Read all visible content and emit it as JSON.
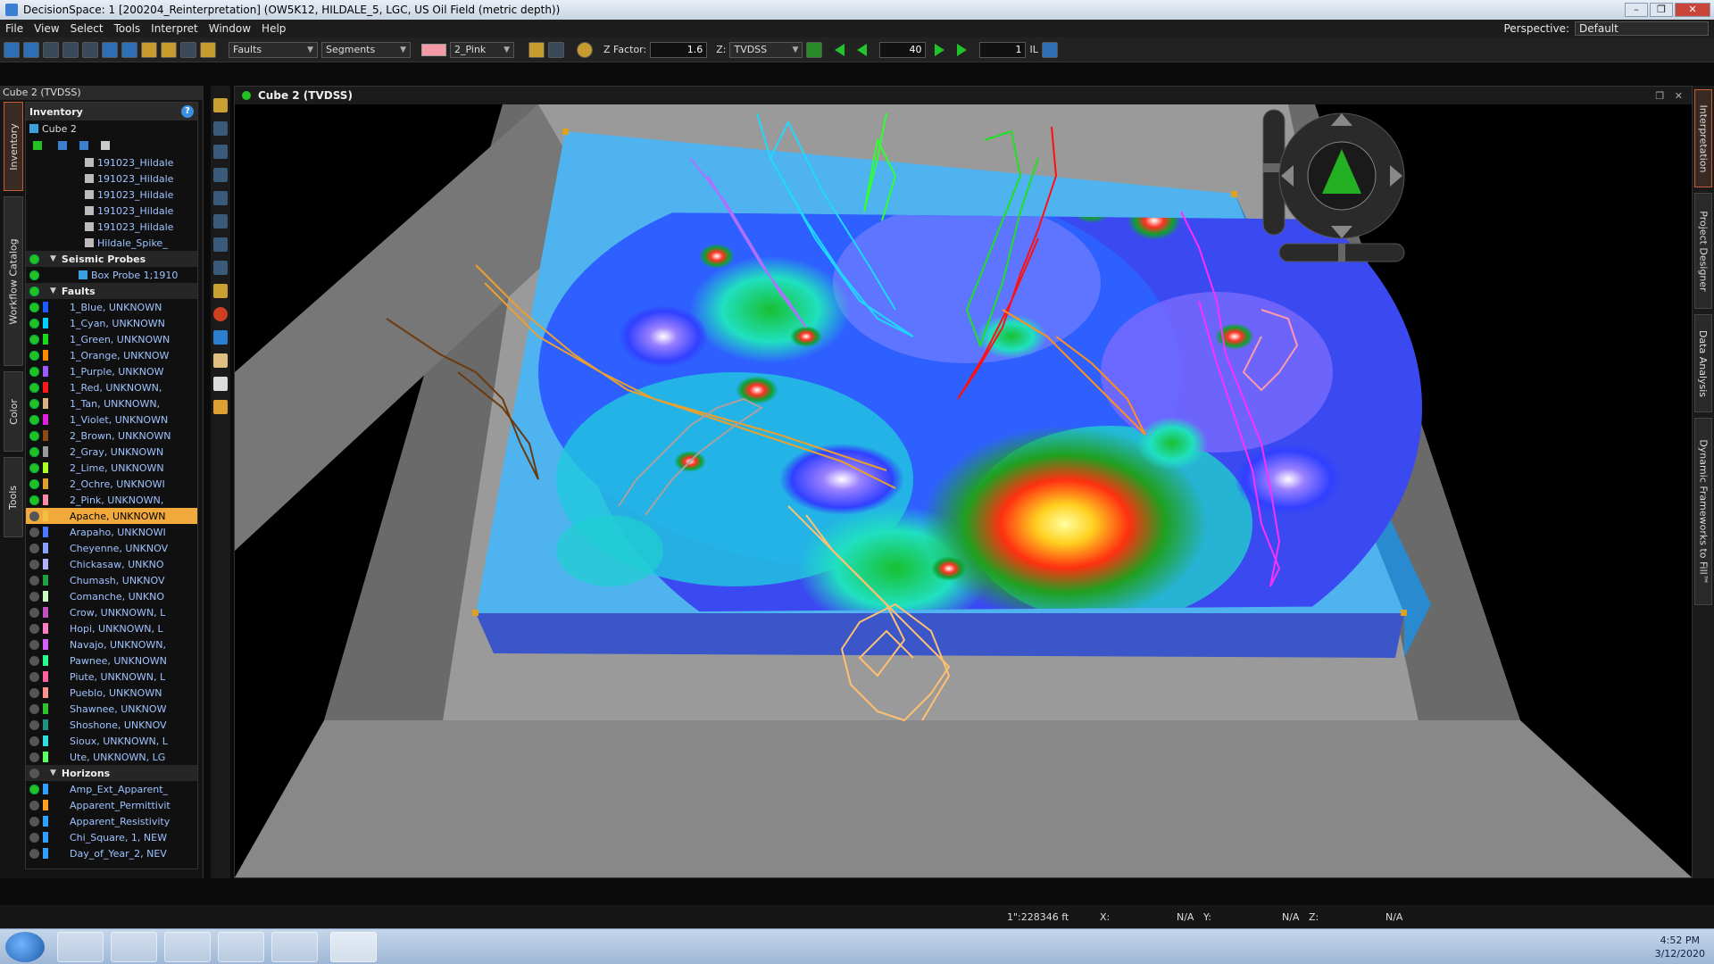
{
  "window": {
    "title": "DecisionSpace: 1 [200204_Reinterpretation] (OW5K12, HILDALE_5, LGC, US Oil Field (metric depth))"
  },
  "menu": [
    "File",
    "View",
    "Select",
    "Tools",
    "Interpret",
    "Window",
    "Help"
  ],
  "perspective": {
    "label": "Perspective:",
    "value": "Default"
  },
  "toolbar": {
    "layer_dropdown": "Faults",
    "mode_dropdown": "Segments",
    "fault_dropdown": "2_Pink",
    "zfactor_label": "Z Factor:",
    "zfactor_value": "1.6",
    "z_label": "Z:",
    "z_dropdown": "TVDSS",
    "frame_value": "40",
    "step_value": "1",
    "il_label": "IL"
  },
  "left_panel": {
    "title": "Cube 2 (TVDSS)",
    "vertical_tabs": [
      "Inventory",
      "Workflow Catalog",
      "Color",
      "Tools"
    ],
    "inventory_title": "Inventory",
    "cube_label": "Cube 2",
    "items": [
      {
        "label": "191023_Hildale",
        "kind": "file"
      },
      {
        "label": "191023_Hildale",
        "kind": "file"
      },
      {
        "label": "191023_Hildale",
        "kind": "file"
      },
      {
        "label": "191023_Hildale",
        "kind": "file"
      },
      {
        "label": "191023_Hildale",
        "kind": "file"
      },
      {
        "label": "Hildale_Spike_",
        "kind": "file"
      }
    ],
    "seismic_group": "Seismic Probes",
    "seismic_items": [
      {
        "label": "Box Probe 1;1910"
      }
    ],
    "faults_group": "Faults",
    "faults": [
      {
        "label": "1_Blue, UNKNOWN",
        "color": "#1f5cff",
        "on": true
      },
      {
        "label": "1_Cyan, UNKNOWN",
        "color": "#00d0ff",
        "on": true
      },
      {
        "label": "1_Green, UNKNOWN",
        "color": "#18d818",
        "on": true
      },
      {
        "label": "1_Orange, UNKNOW",
        "color": "#ff8c00",
        "on": true
      },
      {
        "label": "1_Purple, UNKNOW",
        "color": "#9b59ff",
        "on": true
      },
      {
        "label": "1_Red, UNKNOWN,",
        "color": "#ff1a1a",
        "on": true
      },
      {
        "label": "1_Tan, UNKNOWN,",
        "color": "#d9b384",
        "on": true
      },
      {
        "label": "1_Violet, UNKNOWN",
        "color": "#e020e0",
        "on": true
      },
      {
        "label": "2_Brown, UNKNOWN",
        "color": "#8a4a12",
        "on": true
      },
      {
        "label": "2_Gray, UNKNOWN",
        "color": "#9a9a9a",
        "on": true
      },
      {
        "label": "2_Lime, UNKNOWN",
        "color": "#a8ff20",
        "on": true
      },
      {
        "label": "2_Ochre, UNKNOWI",
        "color": "#e0a030",
        "on": true
      },
      {
        "label": "2_Pink, UNKNOWN,",
        "color": "#ff8aa8",
        "on": true
      },
      {
        "label": "Apache, UNKNOWN",
        "color": "#f2c040",
        "on": false,
        "selected": true
      },
      {
        "label": "Arapaho, UNKNOWI",
        "color": "#4a7aff",
        "on": false
      },
      {
        "label": "Cheyenne, UNKNOV",
        "color": "#8aa0ff",
        "on": false
      },
      {
        "label": "Chickasaw, UNKNO",
        "color": "#b0b0ff",
        "on": false
      },
      {
        "label": "Chumash, UNKNOV",
        "color": "#20a040",
        "on": false
      },
      {
        "label": "Comanche, UNKNO",
        "color": "#c8ffc0",
        "on": false
      },
      {
        "label": "Crow, UNKNOWN, L",
        "color": "#c050c0",
        "on": false
      },
      {
        "label": "Hopi, UNKNOWN, L",
        "color": "#ff80c0",
        "on": false
      },
      {
        "label": "Navajo, UNKNOWN,",
        "color": "#d060ff",
        "on": false
      },
      {
        "label": "Pawnee, UNKNOWN",
        "color": "#20ff90",
        "on": false
      },
      {
        "label": "Piute, UNKNOWN, L",
        "color": "#ff60a0",
        "on": false
      },
      {
        "label": "Pueblo, UNKNOWN",
        "color": "#ff9090",
        "on": false
      },
      {
        "label": "Shawnee, UNKNOW",
        "color": "#30c030",
        "on": false
      },
      {
        "label": "Shoshone, UNKNOV",
        "color": "#209080",
        "on": false
      },
      {
        "label": "Sioux, UNKNOWN, L",
        "color": "#30e0e0",
        "on": false
      },
      {
        "label": "Ute, UNKNOWN, LG",
        "color": "#60ff60",
        "on": false
      }
    ],
    "horizons_group": "Horizons",
    "horizons": [
      {
        "label": "Amp_Ext_Apparent_",
        "color": "#30a0ff",
        "on": true
      },
      {
        "label": "Apparent_Permittivit",
        "color": "#ffa020",
        "on": false
      },
      {
        "label": "Apparent_Resistivity",
        "color": "#30a0ff",
        "on": false
      },
      {
        "label": "Chi_Square, 1, NEW",
        "color": "#30a0ff",
        "on": false
      },
      {
        "label": "Day_of_Year_2, NEV",
        "color": "#30a0ff",
        "on": false
      }
    ]
  },
  "viewport": {
    "title": "Cube 2 (TVDSS)"
  },
  "right_tabs": [
    "Interpretation",
    "Project Designer",
    "Data Analysis",
    "Dynamic Frameworks to Fill™"
  ],
  "status": {
    "scale": "1\":228346 ft",
    "x_label": "X:",
    "x_value": "N/A",
    "y_label": "Y:",
    "y_value": "N/A",
    "z_label": "Z:",
    "z_value": "N/A"
  },
  "taskbar": {
    "time": "4:52 PM",
    "date": "3/12/2020"
  }
}
